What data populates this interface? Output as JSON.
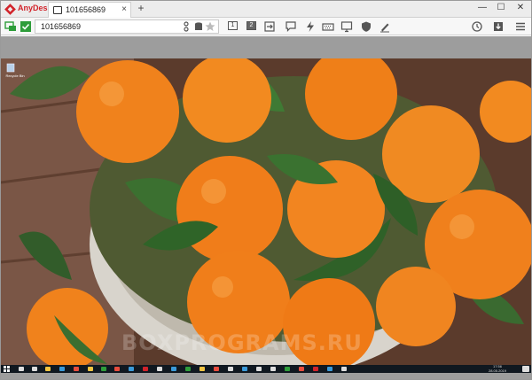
{
  "window": {
    "app_name": "AnyDesk",
    "tab_label": "101656869",
    "tab_close": "×",
    "tab_add": "+",
    "minimize": "—",
    "maximize": "☐",
    "close": "✕"
  },
  "toolbar": {
    "address_value": "101656869",
    "monitor_1": "1",
    "monitor_2": "2",
    "icons": [
      "connected-status-icon",
      "accept-icon",
      "file-transfer-icon",
      "storage-icon",
      "favorite-icon",
      "switch-sides-icon",
      "chat-icon",
      "actions-icon",
      "keyboard-icon",
      "display-icon",
      "permissions-icon",
      "whiteboard-icon",
      "history-icon",
      "install-icon",
      "menu-icon"
    ]
  },
  "remote_desktop": {
    "wallpaper": "tangerines in a basket",
    "desktop_icon_label": "Recycle Bin",
    "watermark": "BOXPROGRAMS.RU",
    "taskbar_time": "17:56",
    "taskbar_date": "28.05.2019"
  },
  "colors": {
    "anydesk_red": "#d2232a",
    "connected_green": "#2e9d3a",
    "taskbar": "#101820"
  }
}
